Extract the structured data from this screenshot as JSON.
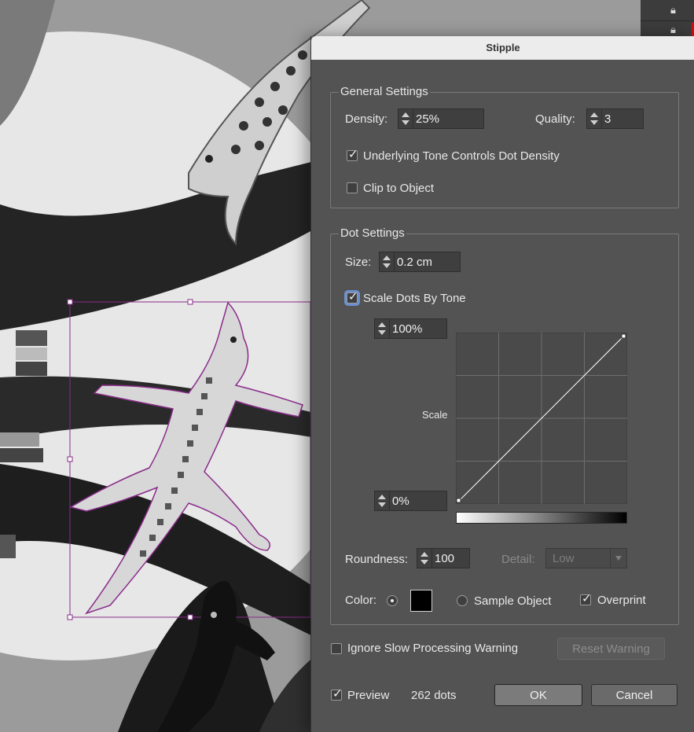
{
  "dialog": {
    "title": "Stipple",
    "general": {
      "title": "General Settings",
      "density_label": "Density:",
      "density_value": "25%",
      "quality_label": "Quality:",
      "quality_value": "3",
      "underlying_tone_label": "Underlying Tone Controls Dot Density",
      "underlying_tone_checked": true,
      "clip_label": "Clip to Object",
      "clip_checked": false
    },
    "dot": {
      "title": "Dot Settings",
      "size_label": "Size:",
      "size_value": "0.2 cm",
      "scale_by_tone_label": "Scale Dots By Tone",
      "scale_by_tone_checked": true,
      "max_value": "100%",
      "min_value": "0%",
      "scale_label": "Scale",
      "roundness_label": "Roundness:",
      "roundness_value": "100",
      "detail_label": "Detail:",
      "detail_value": "Low",
      "color_label": "Color:",
      "color_swatch": "#000000",
      "sample_object_label": "Sample Object",
      "overprint_label": "Overprint",
      "overprint_checked": true
    },
    "ignore_warning_label": "Ignore Slow Processing Warning",
    "ignore_warning_checked": false,
    "reset_warning_label": "Reset Warning",
    "preview_label": "Preview",
    "preview_checked": true,
    "dots_count": "262 dots",
    "ok_label": "OK",
    "cancel_label": "Cancel"
  },
  "colors": {
    "dialog_bg": "#535353",
    "selection": "#8a2b8a",
    "layer_lock_accent": "#d01010"
  },
  "icons": [
    "lock-icon",
    "checkmark-icon",
    "spinner-arrows-icon",
    "chevron-down-icon"
  ]
}
